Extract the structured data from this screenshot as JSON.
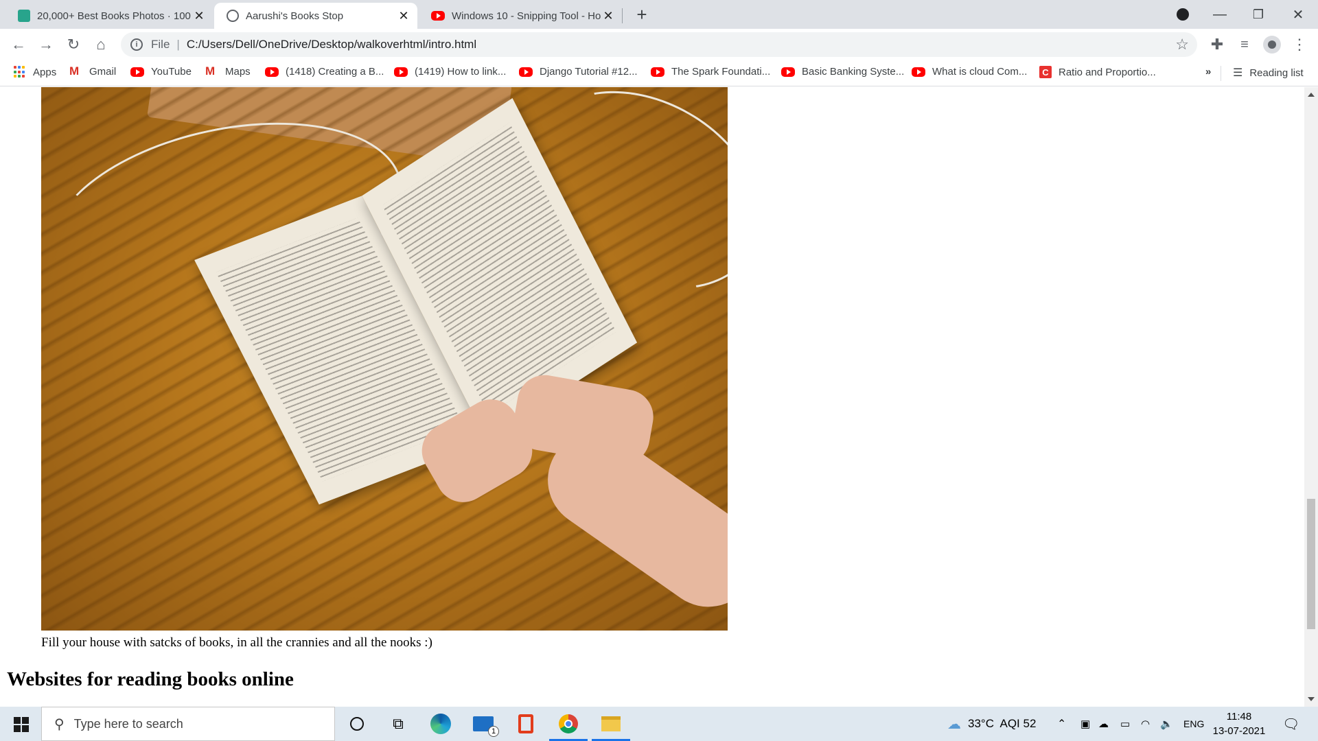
{
  "browser": {
    "tabs": [
      {
        "title": "20,000+ Best Books Photos · 100",
        "icon": "image-site-icon"
      },
      {
        "title": "Aarushi's Books Stop",
        "icon": "globe-icon"
      },
      {
        "title": "Windows 10 - Snipping Tool - Ho",
        "icon": "youtube-icon"
      }
    ],
    "address": {
      "prefix": "File",
      "url": "C:/Users/Dell/OneDrive/Desktop/walkoverhtml/intro.html"
    },
    "bookmarks": [
      {
        "label": "Apps",
        "icon": "apps-icon"
      },
      {
        "label": "Gmail",
        "icon": "gmail-icon"
      },
      {
        "label": "YouTube",
        "icon": "youtube-icon"
      },
      {
        "label": "Maps",
        "icon": "gmail-icon"
      },
      {
        "label": "(1418) Creating a B...",
        "icon": "youtube-icon"
      },
      {
        "label": "(1419) How to link...",
        "icon": "youtube-icon"
      },
      {
        "label": "Django Tutorial #12...",
        "icon": "youtube-icon"
      },
      {
        "label": "The Spark Foundati...",
        "icon": "youtube-icon"
      },
      {
        "label": "Basic Banking Syste...",
        "icon": "youtube-icon"
      },
      {
        "label": "What is cloud Com...",
        "icon": "youtube-icon"
      },
      {
        "label": "Ratio and Proportio...",
        "icon": "c-icon"
      }
    ],
    "overflow": "»",
    "reading_list": "Reading list"
  },
  "page": {
    "caption": "Fill your house with satcks of books, in all the crannies and all the nooks :)",
    "heading": "Websites for reading books online"
  },
  "taskbar": {
    "search_placeholder": "Type here to search",
    "mail_badge": "1",
    "weather": "33°C  AQI 52",
    "language": "ENG",
    "time": "11:48",
    "date": "13-07-2021"
  }
}
